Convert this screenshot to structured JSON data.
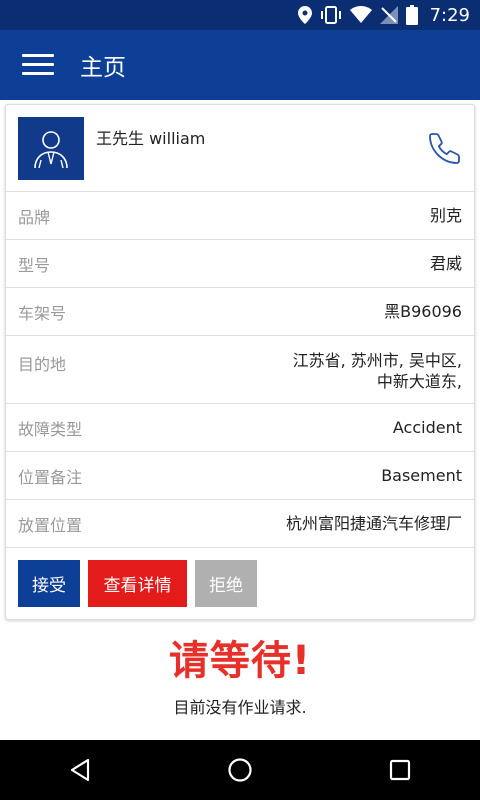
{
  "status_bar": {
    "time": "7:29"
  },
  "app_bar": {
    "title": "主页"
  },
  "card": {
    "customer_name": "王先生 william",
    "rows": [
      {
        "label": "品牌",
        "value": "别克"
      },
      {
        "label": "型号",
        "value": "君威"
      },
      {
        "label": "车架号",
        "value": "黑B96096"
      },
      {
        "label": "目的地",
        "value_line1": "江苏省, 苏州市, 吴中区,",
        "value_line2": "中新大道东,"
      },
      {
        "label": "故障类型",
        "value": "Accident"
      },
      {
        "label": "位置备注",
        "value": "Basement"
      },
      {
        "label": "放置位置",
        "value": "杭州富阳捷通汽车修理厂"
      }
    ],
    "actions": {
      "accept": "接受",
      "details": "查看详情",
      "reject": "拒绝"
    }
  },
  "wait": {
    "title": "请等待!",
    "subtitle": "目前没有作业请求."
  }
}
